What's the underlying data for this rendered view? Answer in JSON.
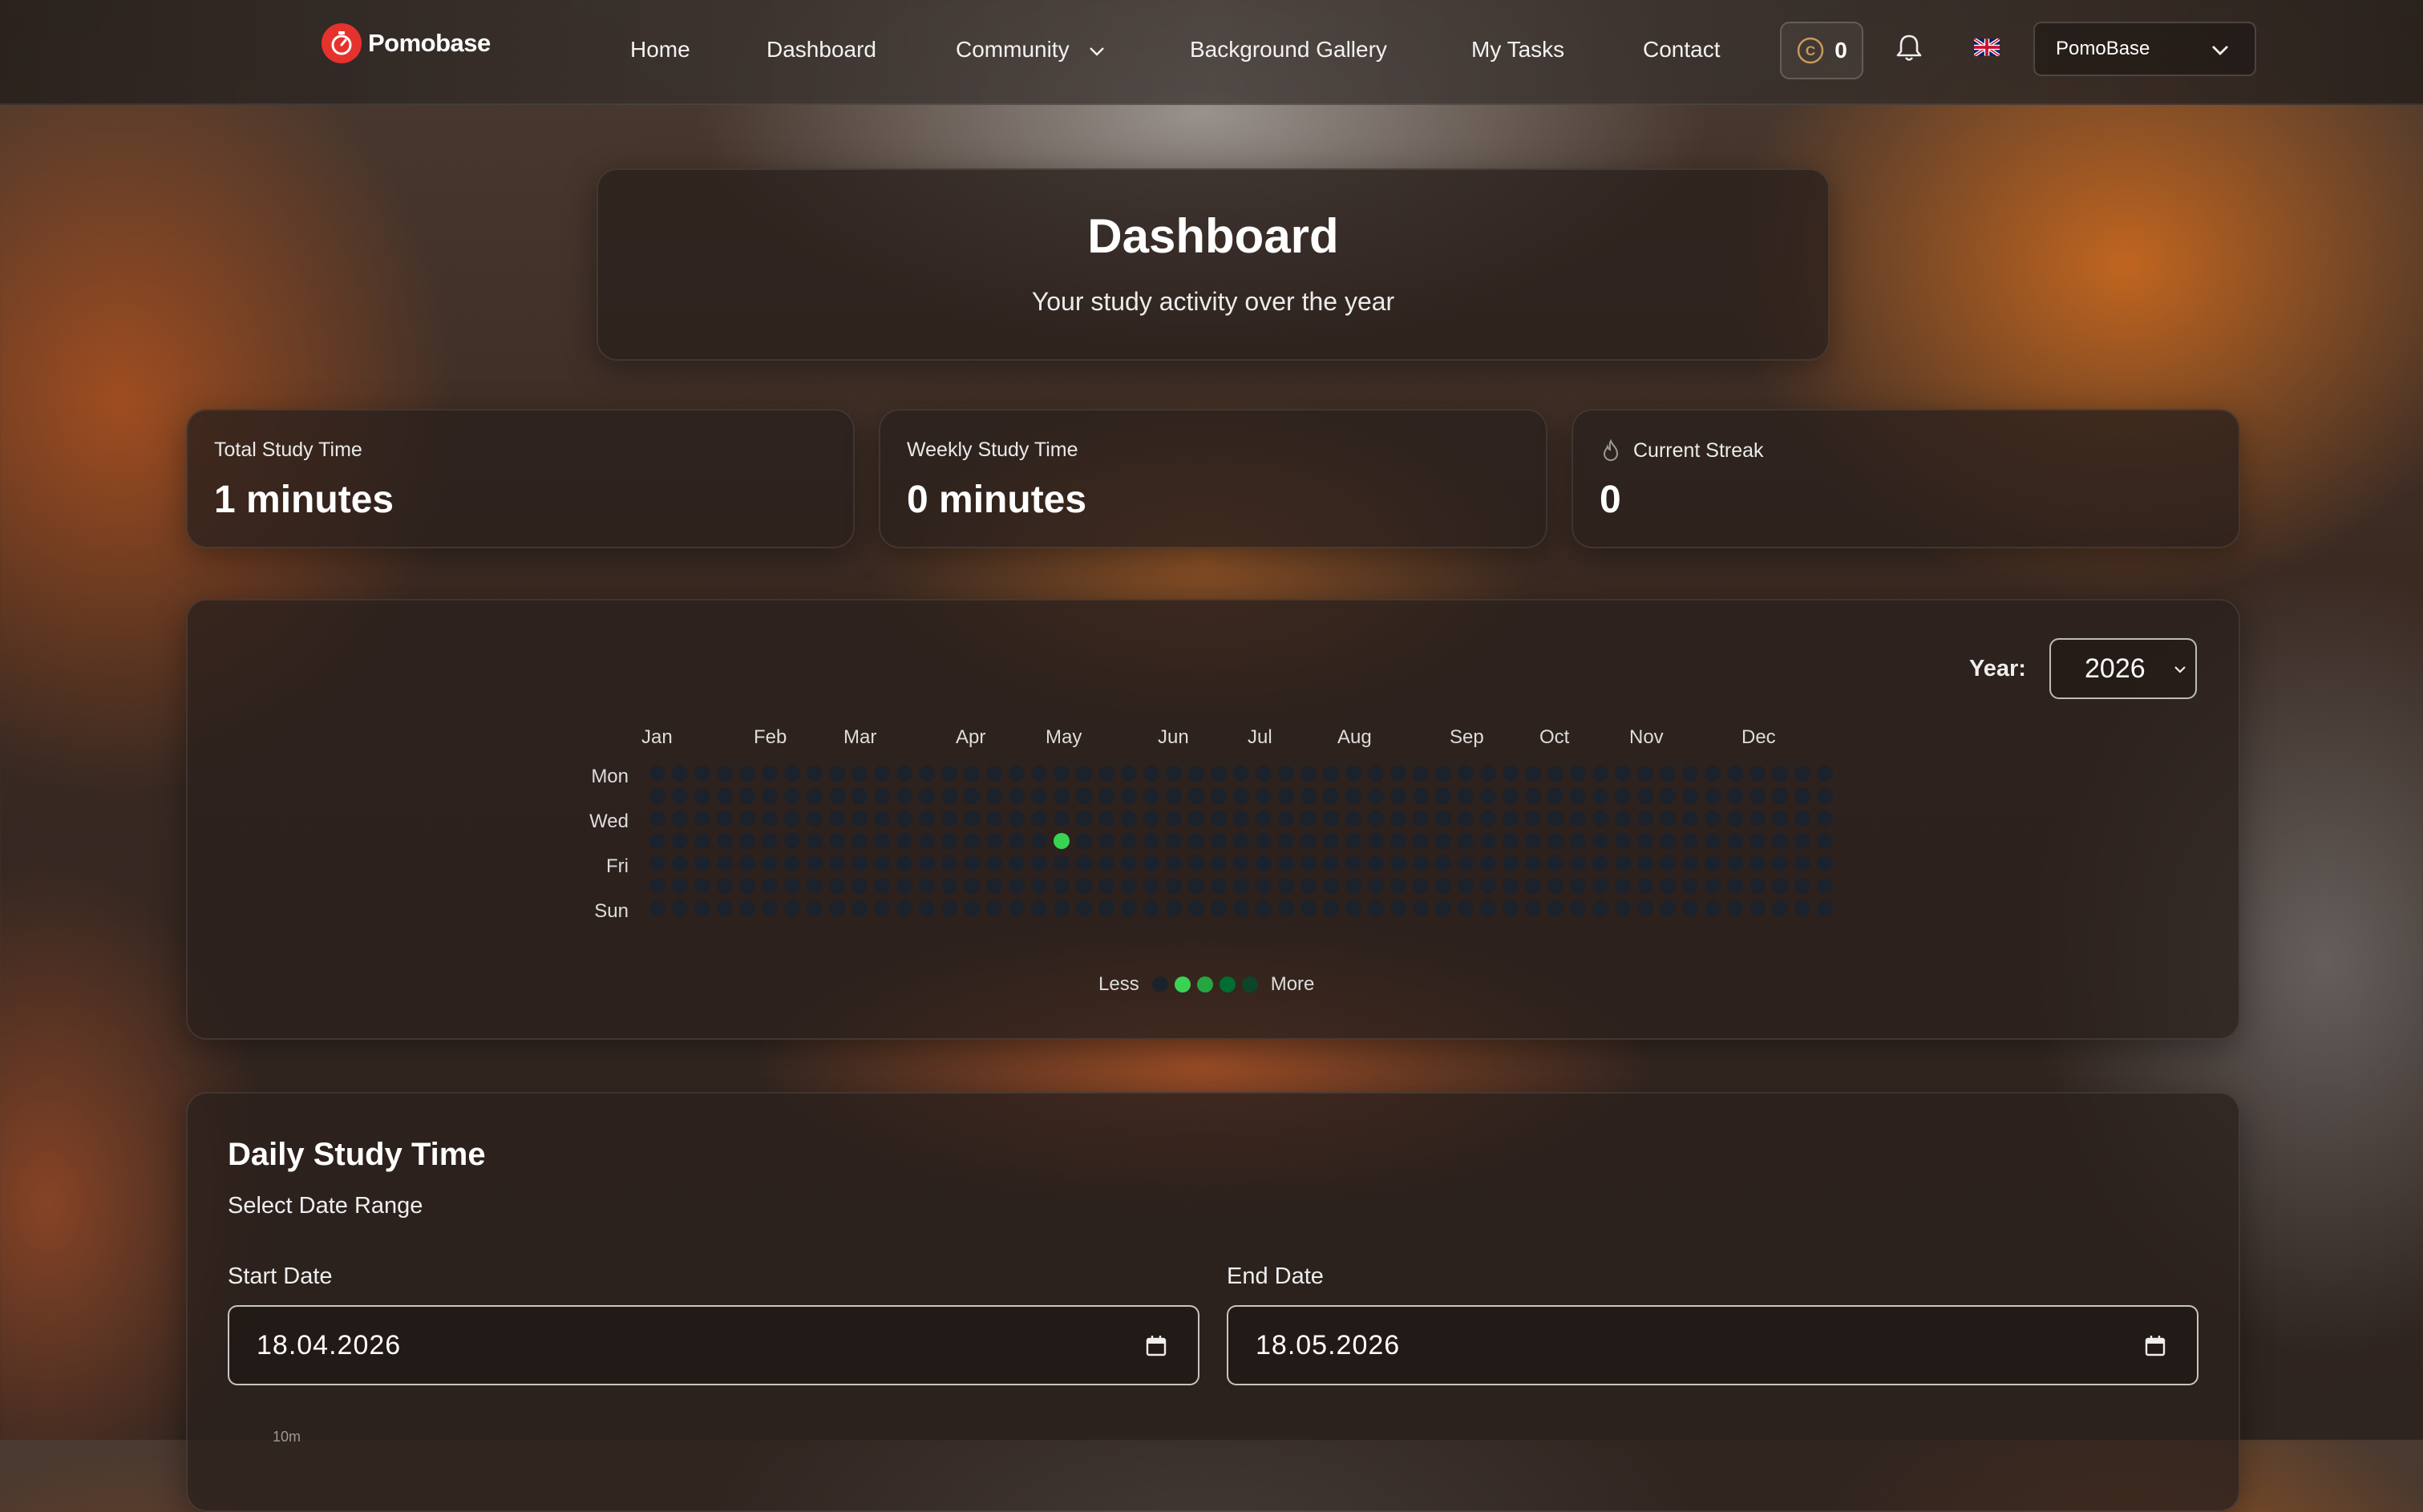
{
  "nav": {
    "brand": "Pomobase",
    "links": [
      "Home",
      "Dashboard",
      "Community",
      "Background Gallery",
      "My Tasks",
      "Contact"
    ],
    "coins": "0",
    "user": "PomoBase"
  },
  "hero": {
    "title": "Dashboard",
    "subtitle": "Your study activity over the year"
  },
  "stats": [
    {
      "label": "Total Study Time",
      "value": "1 minutes"
    },
    {
      "label": "Weekly Study Time",
      "value": "0 minutes"
    },
    {
      "label": "Current Streak",
      "value": "0"
    }
  ],
  "heatmap": {
    "year_label": "Year:",
    "year": "2026",
    "months": [
      "Jan",
      "Feb",
      "Mar",
      "Apr",
      "May",
      "Jun",
      "Jul",
      "Aug",
      "Sep",
      "Oct",
      "Nov",
      "Dec"
    ],
    "days": [
      "Mon",
      "Wed",
      "Fri",
      "Sun"
    ],
    "weeks": 53,
    "active_cell": {
      "week": 18,
      "day": 3
    },
    "legend_less": "Less",
    "legend_more": "More",
    "colors": {
      "empty": "#1c222b",
      "l1": "#39d353",
      "l2": "#26a641",
      "l3": "#006d32",
      "l4": "#0e4429"
    }
  },
  "daily": {
    "title": "Daily Study Time",
    "subtitle": "Select Date Range",
    "start_label": "Start Date",
    "start_value": "18.04.2026",
    "end_label": "End Date",
    "end_value": "18.05.2026",
    "axis_top": "10m"
  }
}
